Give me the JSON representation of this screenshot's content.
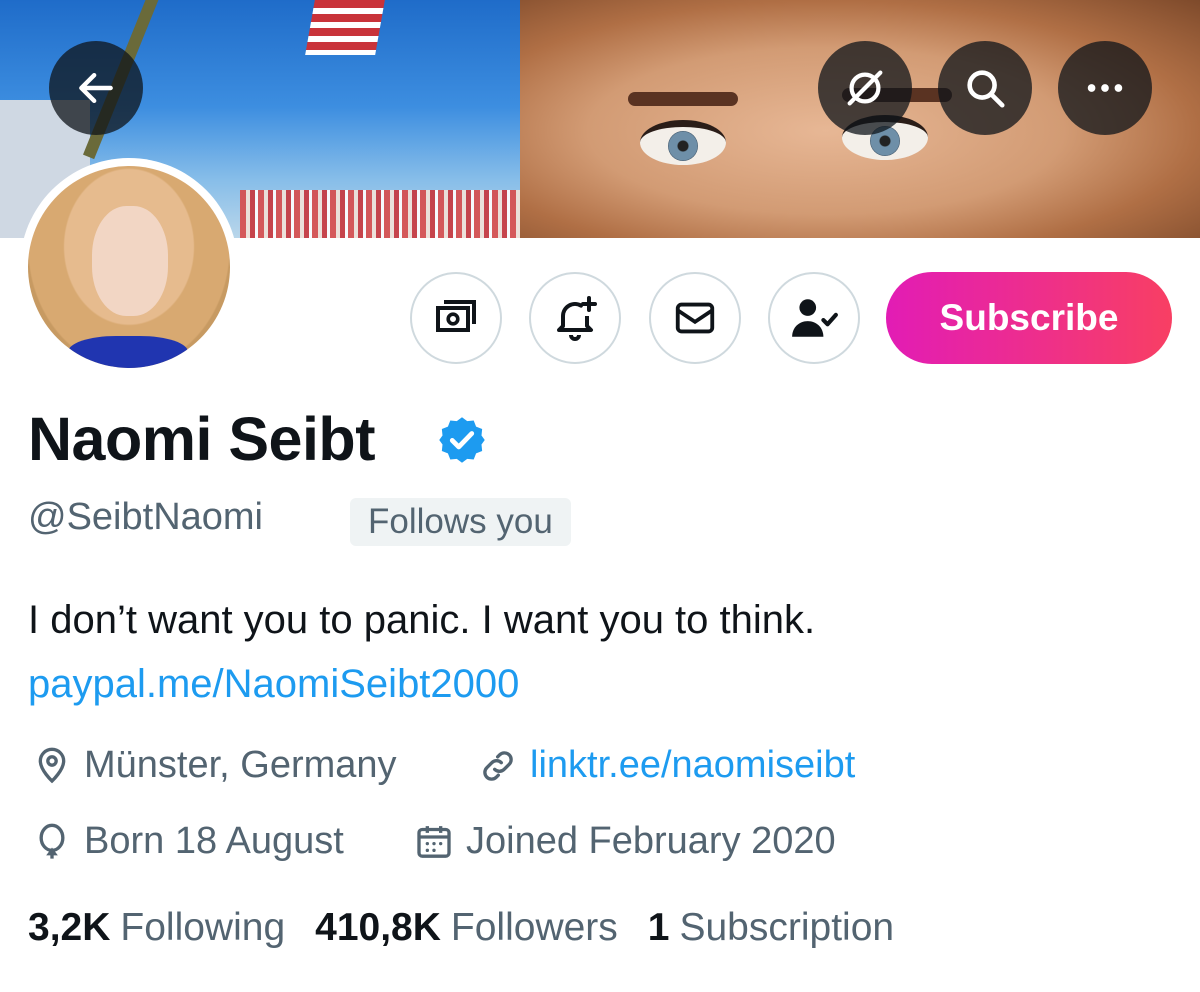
{
  "header": {
    "back_icon": "arrow-left-icon",
    "translate_icon": "slash-circle-icon",
    "search_icon": "search-icon",
    "more_icon": "more-horizontal-icon"
  },
  "profile": {
    "display_name": "Naomi Seibt",
    "verified": true,
    "handle": "@SeibtNaomi",
    "follows_you_badge": "Follows you",
    "bio": "I don’t want you to panic. I want you to think.",
    "bio_link": "paypal.me/NaomiSeibt2000",
    "location": "Münster, Germany",
    "website": "linktr.ee/naomiseibt",
    "birthday": "Born 18 August",
    "joined": "Joined February 2020"
  },
  "actions": {
    "tip_icon": "money-icon",
    "notify_icon": "bell-plus-icon",
    "message_icon": "envelope-icon",
    "following_icon": "person-check-icon",
    "subscribe_label": "Subscribe"
  },
  "stats": {
    "following_count": "3,2K",
    "following_label": "Following",
    "followers_count": "410,8K",
    "followers_label": "Followers",
    "subscriptions_count": "1",
    "subscriptions_label": "Subscription"
  },
  "colors": {
    "link": "#1d9bf0",
    "verified": "#1d9bf0",
    "secondary_text": "#536471",
    "subscribe_gradient_start": "#e21cb5",
    "subscribe_gradient_end": "#f83f63"
  }
}
